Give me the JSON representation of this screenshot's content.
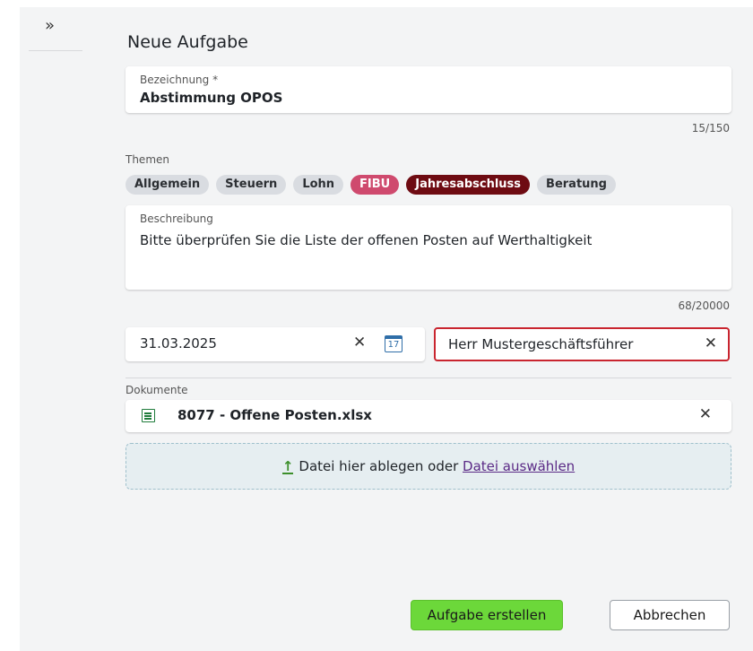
{
  "sidebar": {
    "expand_icon": "chevron-double-right-icon",
    "expand_glyph": "»"
  },
  "form": {
    "title": "Neue Aufgabe",
    "name": {
      "label": "Bezeichnung *",
      "value": "Abstimmung OPOS",
      "counter": "15/150"
    },
    "topics": {
      "label": "Themen",
      "items": [
        {
          "label": "Allgemein",
          "selected": false
        },
        {
          "label": "Steuern",
          "selected": false
        },
        {
          "label": "Lohn",
          "selected": false
        },
        {
          "label": "FIBU",
          "selected": true,
          "color": "#cf4a6e"
        },
        {
          "label": "Jahresabschluss",
          "selected": true,
          "color": "#6e0b12"
        },
        {
          "label": "Beratung",
          "selected": false
        }
      ]
    },
    "description": {
      "label": "Beschreibung",
      "value": "Bitte überprüfen Sie die Liste der offenen Posten auf Werthaltigkeit",
      "counter": "68/20000"
    },
    "due_date": {
      "value": "31.03.2025",
      "clear_glyph": "✕",
      "calendar_day": "17"
    },
    "assignee": {
      "value": "Herr Mustergeschäftsführer",
      "clear_glyph": "✕",
      "border_color": "#c9252f"
    },
    "documents": {
      "label": "Dokumente",
      "files": [
        {
          "name": "8077 - Offene Posten.xlsx",
          "icon": "excel-file-icon",
          "remove_glyph": "✕"
        }
      ],
      "dropzone_text": "Datei hier ablegen oder ",
      "dropzone_link": "Datei auswählen",
      "upload_glyph": "↑"
    }
  },
  "actions": {
    "submit_label": "Aufgabe erstellen",
    "cancel_label": "Abbrechen",
    "submit_color": "#6cd83a"
  }
}
